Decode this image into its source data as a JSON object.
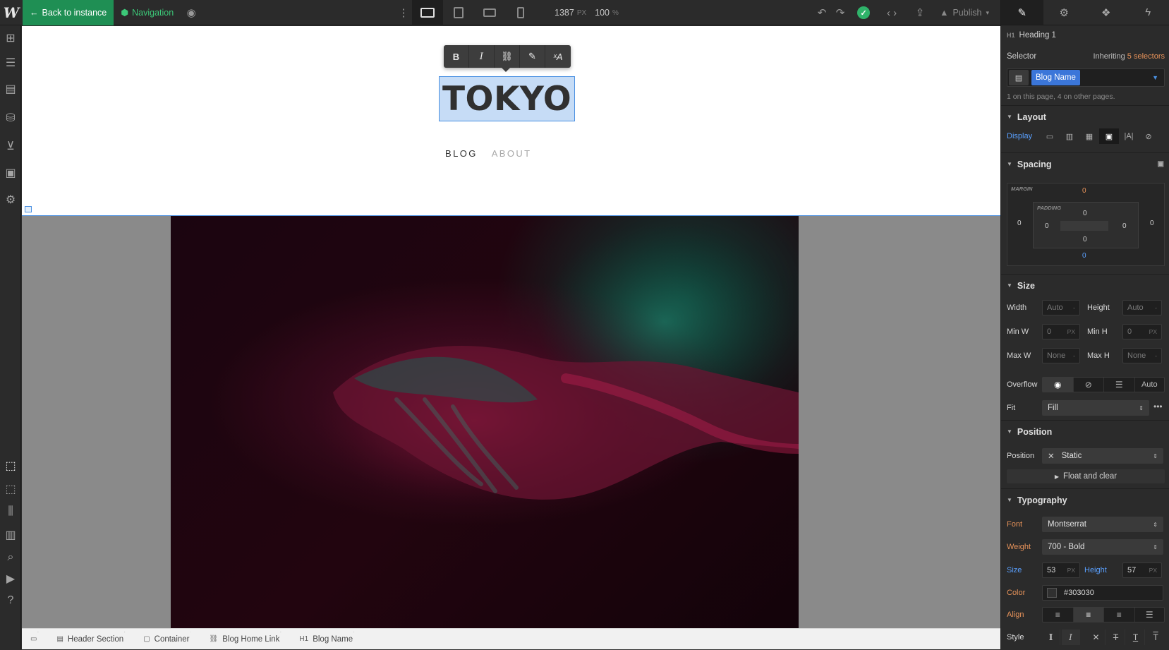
{
  "topbar": {
    "logo": "W",
    "back_label": "Back to instance",
    "nav_label": "Navigation",
    "width_value": "1387",
    "width_unit": "PX",
    "zoom_value": "100",
    "zoom_unit": "%",
    "publish_label": "Publish"
  },
  "canvas": {
    "heading": "TOKYO",
    "nav_links": [
      "BLOG",
      "ABOUT"
    ],
    "format_buttons": [
      "B",
      "I",
      "link-icon",
      "brush-icon",
      "clear-format-icon"
    ]
  },
  "breadcrumbs": [
    {
      "label": "Header Section",
      "icon": "section-icon"
    },
    {
      "label": "Container",
      "icon": "container-icon"
    },
    {
      "label": "Blog Home Link",
      "icon": "link-icon"
    },
    {
      "label": "Blog Name",
      "icon": "H1"
    }
  ],
  "panel": {
    "element_tag": "H1",
    "element_name": "Heading 1",
    "selector_label": "Selector",
    "inheriting_prefix": "Inheriting",
    "inheriting_count": "5 selectors",
    "selector_chip": "Blog Name",
    "selector_info": "1 on this page, 4 on other pages.",
    "sections": {
      "layout": "Layout",
      "spacing": "Spacing",
      "size": "Size",
      "position": "Position",
      "typography": "Typography"
    },
    "display_label": "Display",
    "spacing": {
      "margin_label": "MARGIN",
      "padding_label": "PADDING",
      "margin_top": "0",
      "margin_left": "0",
      "margin_right": "0",
      "margin_bottom": "0",
      "padding_top": "0",
      "padding_left": "0",
      "padding_right": "0",
      "padding_bottom": "0"
    },
    "size": {
      "width_label": "Width",
      "width_value": "Auto",
      "width_unit": "-",
      "height_label": "Height",
      "height_value": "Auto",
      "height_unit": "-",
      "minw_label": "Min W",
      "minw_value": "0",
      "minw_unit": "PX",
      "minh_label": "Min H",
      "minh_value": "0",
      "minh_unit": "PX",
      "maxw_label": "Max W",
      "maxw_value": "None",
      "maxw_unit": "-",
      "maxh_label": "Max H",
      "maxh_value": "None",
      "maxh_unit": "-",
      "overflow_label": "Overflow",
      "overflow_auto": "Auto",
      "fit_label": "Fit",
      "fit_value": "Fill"
    },
    "position": {
      "position_label": "Position",
      "position_value": "Static",
      "float_label": "Float and clear"
    },
    "typography": {
      "font_label": "Font",
      "font_value": "Montserrat",
      "weight_label": "Weight",
      "weight_value": "700 - Bold",
      "size_label": "Size",
      "size_value": "53",
      "size_unit": "PX",
      "height_label": "Height",
      "height_value": "57",
      "height_unit": "PX",
      "color_label": "Color",
      "color_value": "#303030",
      "align_label": "Align",
      "style_label": "Style"
    }
  },
  "colors": {
    "accent_green": "#1f8f54",
    "selection_blue": "#3b76d9",
    "heading_color": "#303030"
  }
}
